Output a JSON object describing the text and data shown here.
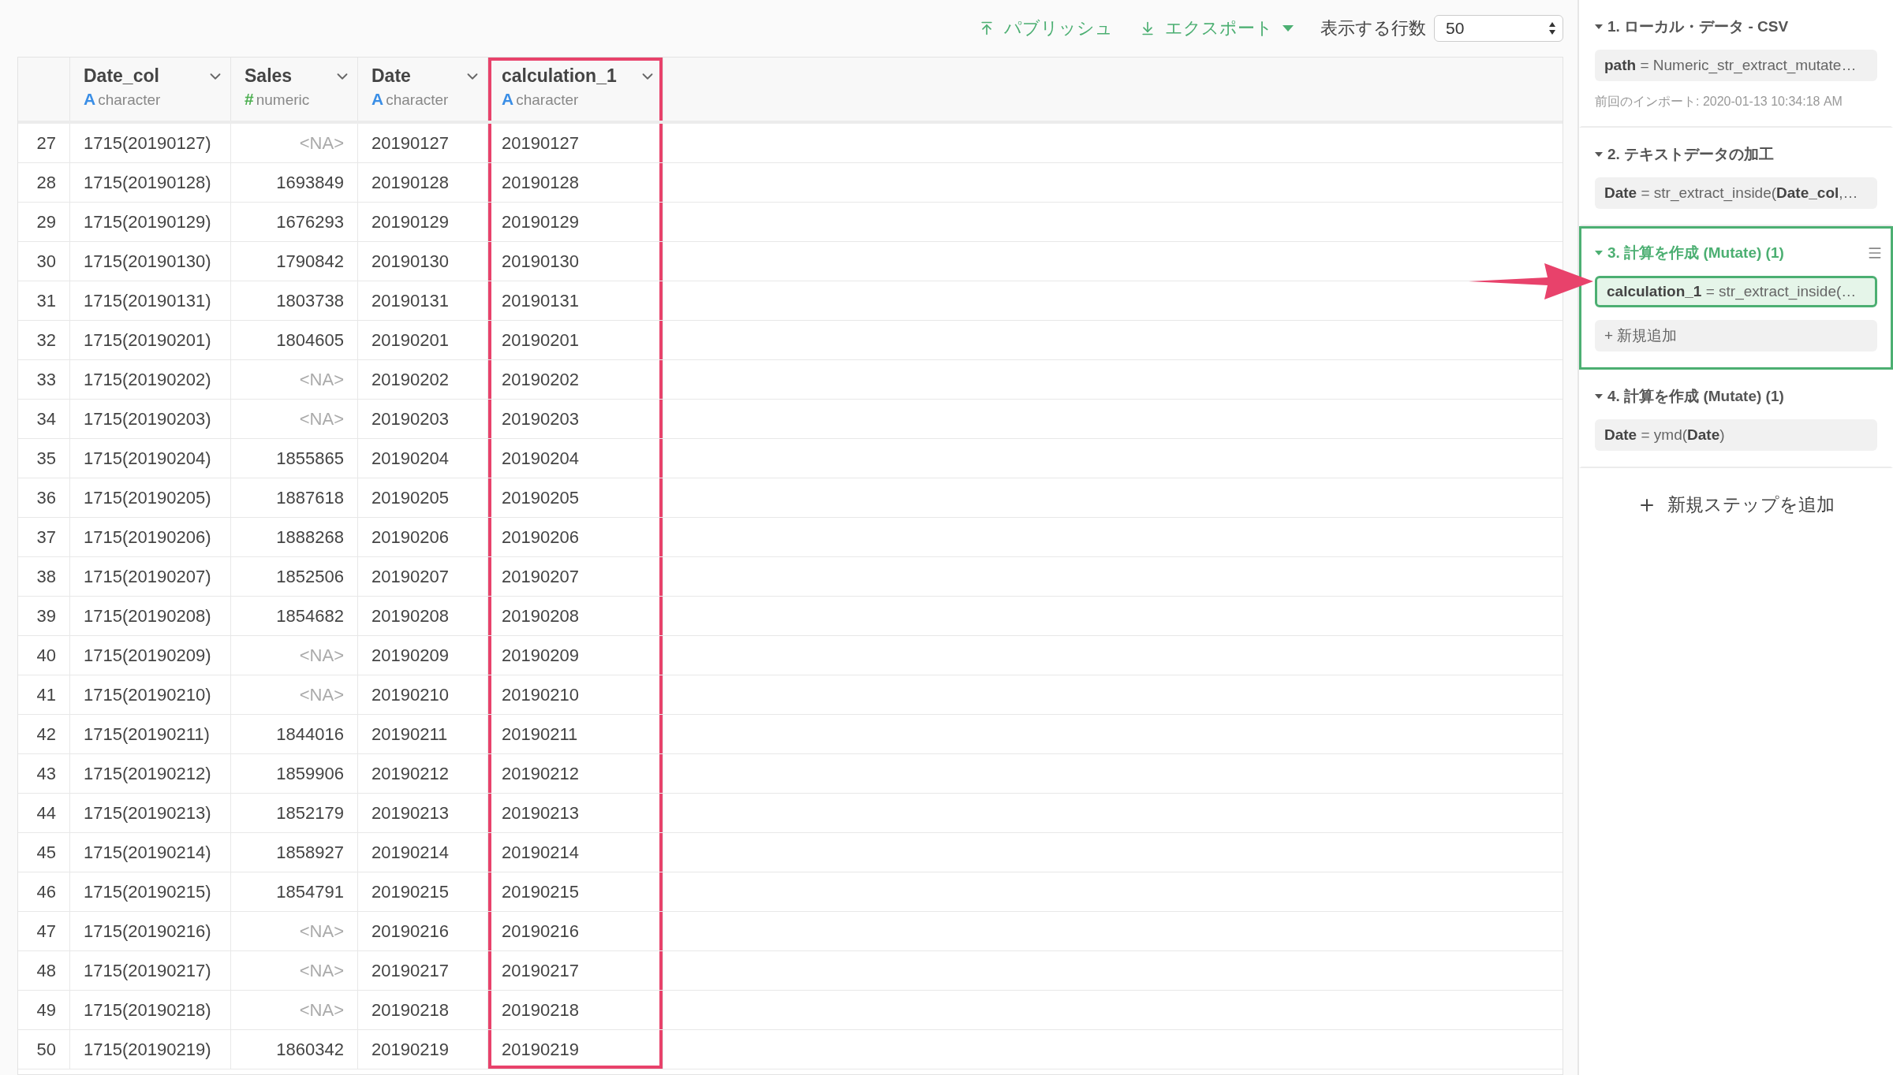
{
  "toolbar": {
    "publish": "パブリッシュ",
    "export": "エクスポート",
    "rows_label": "表示する行数",
    "rows_value": "50"
  },
  "table": {
    "columns": [
      {
        "name": "Date_col",
        "kind": "character",
        "type_icon": "A",
        "type": "character",
        "highlighted": false
      },
      {
        "name": "Sales",
        "kind": "numeric",
        "type_icon": "#",
        "type": "numeric",
        "highlighted": false
      },
      {
        "name": "Date",
        "kind": "character",
        "type_icon": "A",
        "type": "character",
        "highlighted": false
      },
      {
        "name": "calculation_1",
        "kind": "character",
        "type_icon": "A",
        "type": "character",
        "highlighted": true
      }
    ],
    "rows": [
      {
        "n": "27",
        "cells": [
          {
            "v": "1715(20190127)",
            "na": false
          },
          {
            "v": "<NA>",
            "na": true
          },
          {
            "v": "20190127",
            "na": false
          },
          {
            "v": "20190127",
            "na": false
          }
        ]
      },
      {
        "n": "28",
        "cells": [
          {
            "v": "1715(20190128)",
            "na": false
          },
          {
            "v": "1693849",
            "na": false
          },
          {
            "v": "20190128",
            "na": false
          },
          {
            "v": "20190128",
            "na": false
          }
        ]
      },
      {
        "n": "29",
        "cells": [
          {
            "v": "1715(20190129)",
            "na": false
          },
          {
            "v": "1676293",
            "na": false
          },
          {
            "v": "20190129",
            "na": false
          },
          {
            "v": "20190129",
            "na": false
          }
        ]
      },
      {
        "n": "30",
        "cells": [
          {
            "v": "1715(20190130)",
            "na": false
          },
          {
            "v": "1790842",
            "na": false
          },
          {
            "v": "20190130",
            "na": false
          },
          {
            "v": "20190130",
            "na": false
          }
        ]
      },
      {
        "n": "31",
        "cells": [
          {
            "v": "1715(20190131)",
            "na": false
          },
          {
            "v": "1803738",
            "na": false
          },
          {
            "v": "20190131",
            "na": false
          },
          {
            "v": "20190131",
            "na": false
          }
        ]
      },
      {
        "n": "32",
        "cells": [
          {
            "v": "1715(20190201)",
            "na": false
          },
          {
            "v": "1804605",
            "na": false
          },
          {
            "v": "20190201",
            "na": false
          },
          {
            "v": "20190201",
            "na": false
          }
        ]
      },
      {
        "n": "33",
        "cells": [
          {
            "v": "1715(20190202)",
            "na": false
          },
          {
            "v": "<NA>",
            "na": true
          },
          {
            "v": "20190202",
            "na": false
          },
          {
            "v": "20190202",
            "na": false
          }
        ]
      },
      {
        "n": "34",
        "cells": [
          {
            "v": "1715(20190203)",
            "na": false
          },
          {
            "v": "<NA>",
            "na": true
          },
          {
            "v": "20190203",
            "na": false
          },
          {
            "v": "20190203",
            "na": false
          }
        ]
      },
      {
        "n": "35",
        "cells": [
          {
            "v": "1715(20190204)",
            "na": false
          },
          {
            "v": "1855865",
            "na": false
          },
          {
            "v": "20190204",
            "na": false
          },
          {
            "v": "20190204",
            "na": false
          }
        ]
      },
      {
        "n": "36",
        "cells": [
          {
            "v": "1715(20190205)",
            "na": false
          },
          {
            "v": "1887618",
            "na": false
          },
          {
            "v": "20190205",
            "na": false
          },
          {
            "v": "20190205",
            "na": false
          }
        ]
      },
      {
        "n": "37",
        "cells": [
          {
            "v": "1715(20190206)",
            "na": false
          },
          {
            "v": "1888268",
            "na": false
          },
          {
            "v": "20190206",
            "na": false
          },
          {
            "v": "20190206",
            "na": false
          }
        ]
      },
      {
        "n": "38",
        "cells": [
          {
            "v": "1715(20190207)",
            "na": false
          },
          {
            "v": "1852506",
            "na": false
          },
          {
            "v": "20190207",
            "na": false
          },
          {
            "v": "20190207",
            "na": false
          }
        ]
      },
      {
        "n": "39",
        "cells": [
          {
            "v": "1715(20190208)",
            "na": false
          },
          {
            "v": "1854682",
            "na": false
          },
          {
            "v": "20190208",
            "na": false
          },
          {
            "v": "20190208",
            "na": false
          }
        ]
      },
      {
        "n": "40",
        "cells": [
          {
            "v": "1715(20190209)",
            "na": false
          },
          {
            "v": "<NA>",
            "na": true
          },
          {
            "v": "20190209",
            "na": false
          },
          {
            "v": "20190209",
            "na": false
          }
        ]
      },
      {
        "n": "41",
        "cells": [
          {
            "v": "1715(20190210)",
            "na": false
          },
          {
            "v": "<NA>",
            "na": true
          },
          {
            "v": "20190210",
            "na": false
          },
          {
            "v": "20190210",
            "na": false
          }
        ]
      },
      {
        "n": "42",
        "cells": [
          {
            "v": "1715(20190211)",
            "na": false
          },
          {
            "v": "1844016",
            "na": false
          },
          {
            "v": "20190211",
            "na": false
          },
          {
            "v": "20190211",
            "na": false
          }
        ]
      },
      {
        "n": "43",
        "cells": [
          {
            "v": "1715(20190212)",
            "na": false
          },
          {
            "v": "1859906",
            "na": false
          },
          {
            "v": "20190212",
            "na": false
          },
          {
            "v": "20190212",
            "na": false
          }
        ]
      },
      {
        "n": "44",
        "cells": [
          {
            "v": "1715(20190213)",
            "na": false
          },
          {
            "v": "1852179",
            "na": false
          },
          {
            "v": "20190213",
            "na": false
          },
          {
            "v": "20190213",
            "na": false
          }
        ]
      },
      {
        "n": "45",
        "cells": [
          {
            "v": "1715(20190214)",
            "na": false
          },
          {
            "v": "1858927",
            "na": false
          },
          {
            "v": "20190214",
            "na": false
          },
          {
            "v": "20190214",
            "na": false
          }
        ]
      },
      {
        "n": "46",
        "cells": [
          {
            "v": "1715(20190215)",
            "na": false
          },
          {
            "v": "1854791",
            "na": false
          },
          {
            "v": "20190215",
            "na": false
          },
          {
            "v": "20190215",
            "na": false
          }
        ]
      },
      {
        "n": "47",
        "cells": [
          {
            "v": "1715(20190216)",
            "na": false
          },
          {
            "v": "<NA>",
            "na": true
          },
          {
            "v": "20190216",
            "na": false
          },
          {
            "v": "20190216",
            "na": false
          }
        ]
      },
      {
        "n": "48",
        "cells": [
          {
            "v": "1715(20190217)",
            "na": false
          },
          {
            "v": "<NA>",
            "na": true
          },
          {
            "v": "20190217",
            "na": false
          },
          {
            "v": "20190217",
            "na": false
          }
        ]
      },
      {
        "n": "49",
        "cells": [
          {
            "v": "1715(20190218)",
            "na": false
          },
          {
            "v": "<NA>",
            "na": true
          },
          {
            "v": "20190218",
            "na": false
          },
          {
            "v": "20190218",
            "na": false
          }
        ]
      },
      {
        "n": "50",
        "cells": [
          {
            "v": "1715(20190219)",
            "na": false
          },
          {
            "v": "1860342",
            "na": false
          },
          {
            "v": "20190219",
            "na": false
          },
          {
            "v": "20190219",
            "na": false
          }
        ]
      }
    ]
  },
  "steps": [
    {
      "title": "1. ローカル・データ - CSV",
      "expanded": true,
      "selected": false,
      "items": [
        {
          "kind": "chip",
          "text": "**path** = Numeric_str_extract_mutate…",
          "selected": false
        },
        {
          "kind": "note",
          "text": "前回のインポート: 2020-01-13 10:34:18 AM"
        }
      ]
    },
    {
      "title": "2. テキストデータの加工",
      "expanded": true,
      "selected": false,
      "items": [
        {
          "kind": "chip",
          "text": "**Date** = str_extract_inside(**Date_col**,…",
          "selected": false
        }
      ]
    },
    {
      "title": "3. 計算を作成 (Mutate) (1)",
      "expanded": true,
      "selected": true,
      "items": [
        {
          "kind": "chip",
          "text": "**calculation_1** = str_extract_inside(…",
          "selected": true
        },
        {
          "kind": "add",
          "text": "+ 新規追加",
          "selected": false
        }
      ]
    },
    {
      "title": "4. 計算を作成 (Mutate) (1)",
      "expanded": true,
      "selected": false,
      "items": [
        {
          "kind": "chip",
          "text": "**Date** = ymd(**Date**)",
          "selected": false
        }
      ]
    }
  ],
  "add_step": "新規ステップを追加"
}
